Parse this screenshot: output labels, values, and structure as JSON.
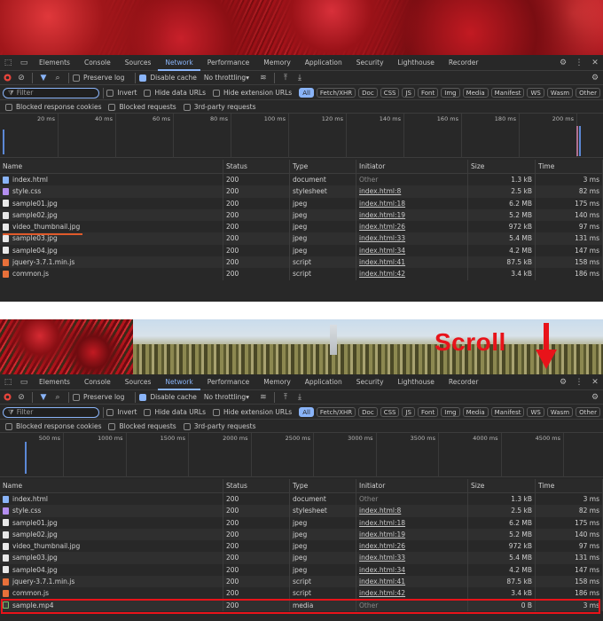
{
  "tabs": [
    "Elements",
    "Console",
    "Sources",
    "Network",
    "Performance",
    "Memory",
    "Application",
    "Security",
    "Lighthouse",
    "Recorder"
  ],
  "toolbar": {
    "preserve_log": "Preserve log",
    "disable_cache": "Disable cache",
    "throttling": "No throttling"
  },
  "filter": {
    "placeholder": "Filter",
    "invert": "Invert",
    "hide_data_urls": "Hide data URLs",
    "hide_extension_urls": "Hide extension URLs",
    "types": [
      "All",
      "Fetch/XHR",
      "Doc",
      "CSS",
      "JS",
      "Font",
      "Img",
      "Media",
      "Manifest",
      "WS",
      "Wasm",
      "Other"
    ]
  },
  "options": {
    "blocked_cookies": "Blocked response cookies",
    "blocked_requests": "Blocked requests",
    "third_party": "3rd-party requests"
  },
  "annotation": {
    "scroll": "Scroll"
  },
  "overview1": {
    "ticks": [
      "20 ms",
      "40 ms",
      "60 ms",
      "80 ms",
      "100 ms",
      "120 ms",
      "140 ms",
      "160 ms",
      "180 ms",
      "200 ms"
    ]
  },
  "overview2": {
    "ticks": [
      "500 ms",
      "1000 ms",
      "1500 ms",
      "2000 ms",
      "2500 ms",
      "3000 ms",
      "3500 ms",
      "4000 ms",
      "4500 ms"
    ]
  },
  "columns": {
    "name": "Name",
    "status": "Status",
    "type": "Type",
    "initiator": "Initiator",
    "size": "Size",
    "time": "Time"
  },
  "rows": [
    {
      "name": "index.html",
      "status": "200",
      "type": "document",
      "initiator": "Other",
      "size": "1.3 kB",
      "time": "3 ms",
      "icon": "doc"
    },
    {
      "name": "style.css",
      "status": "200",
      "type": "stylesheet",
      "initiator": "index.html:8",
      "size": "2.5 kB",
      "time": "82 ms",
      "icon": "css"
    },
    {
      "name": "sample01.jpg",
      "status": "200",
      "type": "jpeg",
      "initiator": "index.html:18",
      "size": "6.2 MB",
      "time": "175 ms",
      "icon": "img"
    },
    {
      "name": "sample02.jpg",
      "status": "200",
      "type": "jpeg",
      "initiator": "index.html:19",
      "size": "5.2 MB",
      "time": "140 ms",
      "icon": "img"
    },
    {
      "name": "video_thumbnail.jpg",
      "status": "200",
      "type": "jpeg",
      "initiator": "index.html:26",
      "size": "972 kB",
      "time": "97 ms",
      "icon": "img"
    },
    {
      "name": "sample03.jpg",
      "status": "200",
      "type": "jpeg",
      "initiator": "index.html:33",
      "size": "5.4 MB",
      "time": "131 ms",
      "icon": "img"
    },
    {
      "name": "sample04.jpg",
      "status": "200",
      "type": "jpeg",
      "initiator": "index.html:34",
      "size": "4.2 MB",
      "time": "147 ms",
      "icon": "img"
    },
    {
      "name": "jquery-3.7.1.min.js",
      "status": "200",
      "type": "script",
      "initiator": "index.html:41",
      "size": "87.5 kB",
      "time": "158 ms",
      "icon": "js"
    },
    {
      "name": "common.js",
      "status": "200",
      "type": "script",
      "initiator": "index.html:42",
      "size": "3.4 kB",
      "time": "186 ms",
      "icon": "js"
    }
  ],
  "extra_row": {
    "name": "sample.mp4",
    "status": "200",
    "type": "media",
    "initiator": "Other",
    "size": "0 B",
    "time": "3 ms",
    "icon": "media"
  },
  "colors": {
    "accent": "#8ab4f8",
    "highlight": "#e8131a",
    "underline": "#e05a2a"
  }
}
